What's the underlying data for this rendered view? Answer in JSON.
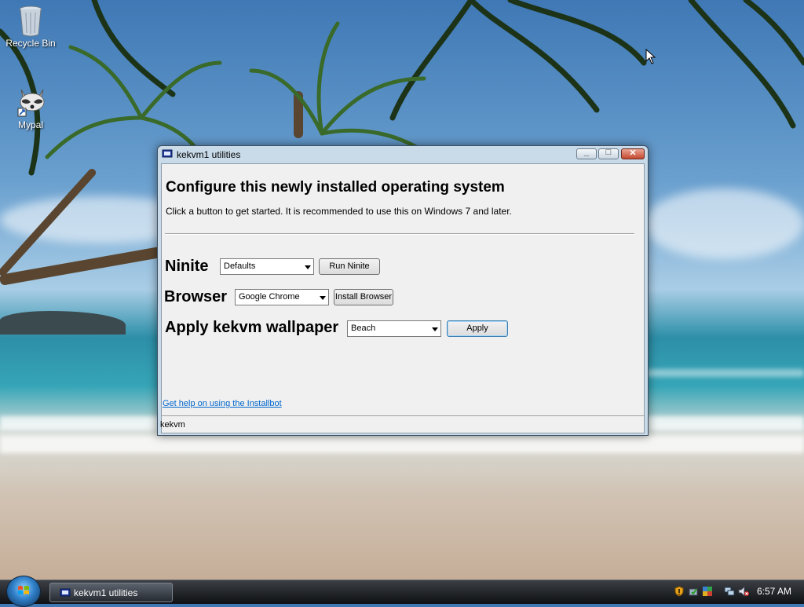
{
  "desktop": {
    "icons": [
      {
        "label": "Recycle Bin",
        "icon": "recycle-bin-icon"
      },
      {
        "label": "Mypal",
        "icon": "mypal-raccoon-icon"
      }
    ]
  },
  "window": {
    "title": "kekvm1 utilities",
    "heading": "Configure this newly installed operating system",
    "subtext": "Click a button to get started. It is recommended to use this on Windows 7 and later.",
    "ninite": {
      "label": "Ninite",
      "selected": "Defaults",
      "button": "Run Ninite"
    },
    "browser": {
      "label": "Browser",
      "selected": "Google Chrome",
      "button": "Install Browser"
    },
    "wallpaper": {
      "label": "Apply kekvm wallpaper",
      "selected": "Beach",
      "button": "Apply"
    },
    "help_link": "Get help on using the Installbot",
    "status": "kekvm"
  },
  "taskbar": {
    "task_label": "kekvm1 utilities",
    "clock": "6:57 AM",
    "tray_icons": [
      "security-shield-icon",
      "safely-remove-icon",
      "network-flag-icon",
      "network-icon",
      "volume-muted-icon"
    ]
  },
  "colors": {
    "accent": "#3c7fb1",
    "link": "#0066cc",
    "close": "#c4482f"
  }
}
